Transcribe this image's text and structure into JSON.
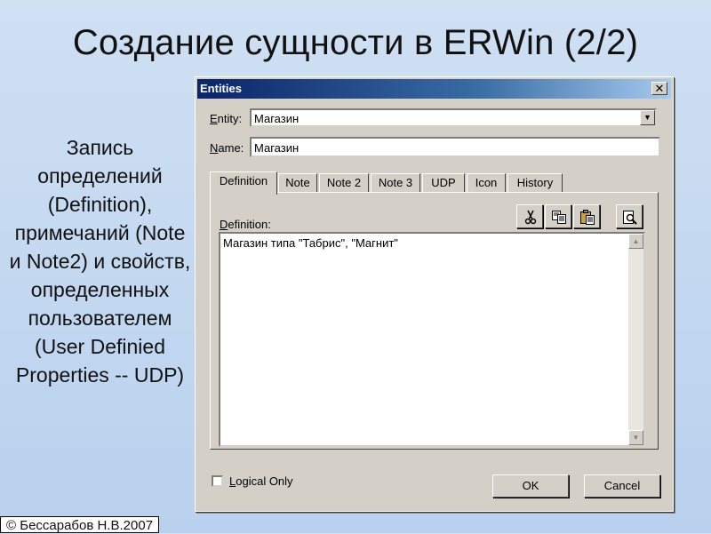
{
  "slide": {
    "title": "Создание сущности в ERWin (2/2)",
    "left_text": "Запись определений (Definition), примечаний (Note и Note2) и свойств, определенных пользователем (User Definied Properties -- UDP)",
    "footer": "© Бессарабов Н.В.2007"
  },
  "dialog": {
    "title": "Entities",
    "close_glyph": "✕",
    "entity_label_first": "E",
    "entity_label_rest": "ntity:",
    "entity_value": "Магазин",
    "name_label_first": "N",
    "name_label_rest": "ame:",
    "name_value": "Магазин",
    "tabs": [
      "Definition",
      "Note",
      "Note 2",
      "Note 3",
      "UDP",
      "Icon",
      "History"
    ],
    "definition_label_first": "D",
    "definition_label_rest": "efinition:",
    "definition_text": "Магазин типа \"Табрис\", \"Магнит\"",
    "toolbar_icons": [
      "cut-icon",
      "copy-icon",
      "paste-icon",
      "preview-icon"
    ],
    "logical_only_first": "L",
    "logical_only_rest": "ogical Only",
    "ok_label": "OK",
    "cancel_label": "Cancel"
  },
  "colors": {
    "title_bar_start": "#0a246a",
    "title_bar_end": "#a6caf0",
    "dialog_face": "#d4d0c8",
    "slide_bg": "#c4d8f0"
  }
}
